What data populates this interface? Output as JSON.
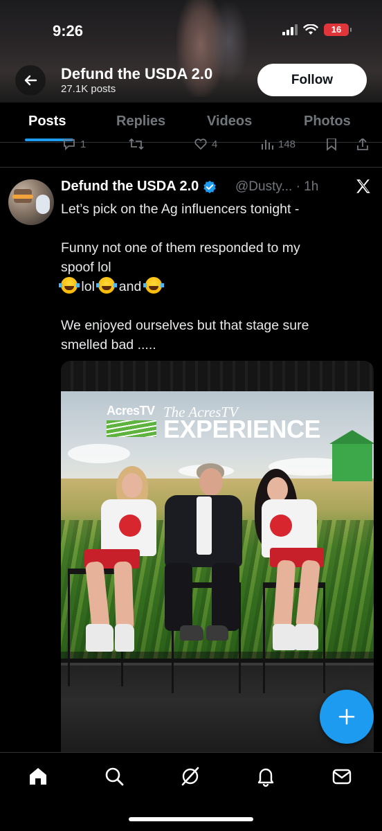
{
  "status_bar": {
    "time": "9:26",
    "battery": "16"
  },
  "header": {
    "title": "Defund the USDA 2.0",
    "posts_count": "27.1K posts",
    "follow_label": "Follow"
  },
  "tabs": [
    {
      "label": "Posts",
      "active": true
    },
    {
      "label": "Replies",
      "active": false
    },
    {
      "label": "Videos",
      "active": false
    },
    {
      "label": "Photos",
      "active": false
    }
  ],
  "previous_post_actions": {
    "replies": "1",
    "likes": "4",
    "views": "148"
  },
  "post": {
    "author_name": "Defund the USDA 2.0",
    "handle": "@Dusty...",
    "time": "· 1h",
    "line1": "Let’s pick on the Ag influencers tonight -",
    "line2": "Funny not one of them responded to my",
    "line3": "spoof lol",
    "line4_a": "lol",
    "line4_b": "and",
    "line5": "We enjoyed ourselves but that stage sure",
    "line6": "smelled bad .....",
    "image": {
      "brand": "AcresTV",
      "title_script": "The AcresTV",
      "title_big": "EXPERIENCE"
    }
  },
  "icons": {
    "back": "arrow-left-icon",
    "verified": "verified-badge-icon",
    "x_logo": "x-logo-icon",
    "compose": "plus-icon",
    "nav": [
      "home-icon",
      "search-icon",
      "grok-icon",
      "notifications-icon",
      "messages-icon"
    ]
  },
  "colors": {
    "accent": "#1d9bf0",
    "background": "#000000",
    "text": "#e7e9ea",
    "muted": "#71767b",
    "battery": "#e0363b"
  }
}
